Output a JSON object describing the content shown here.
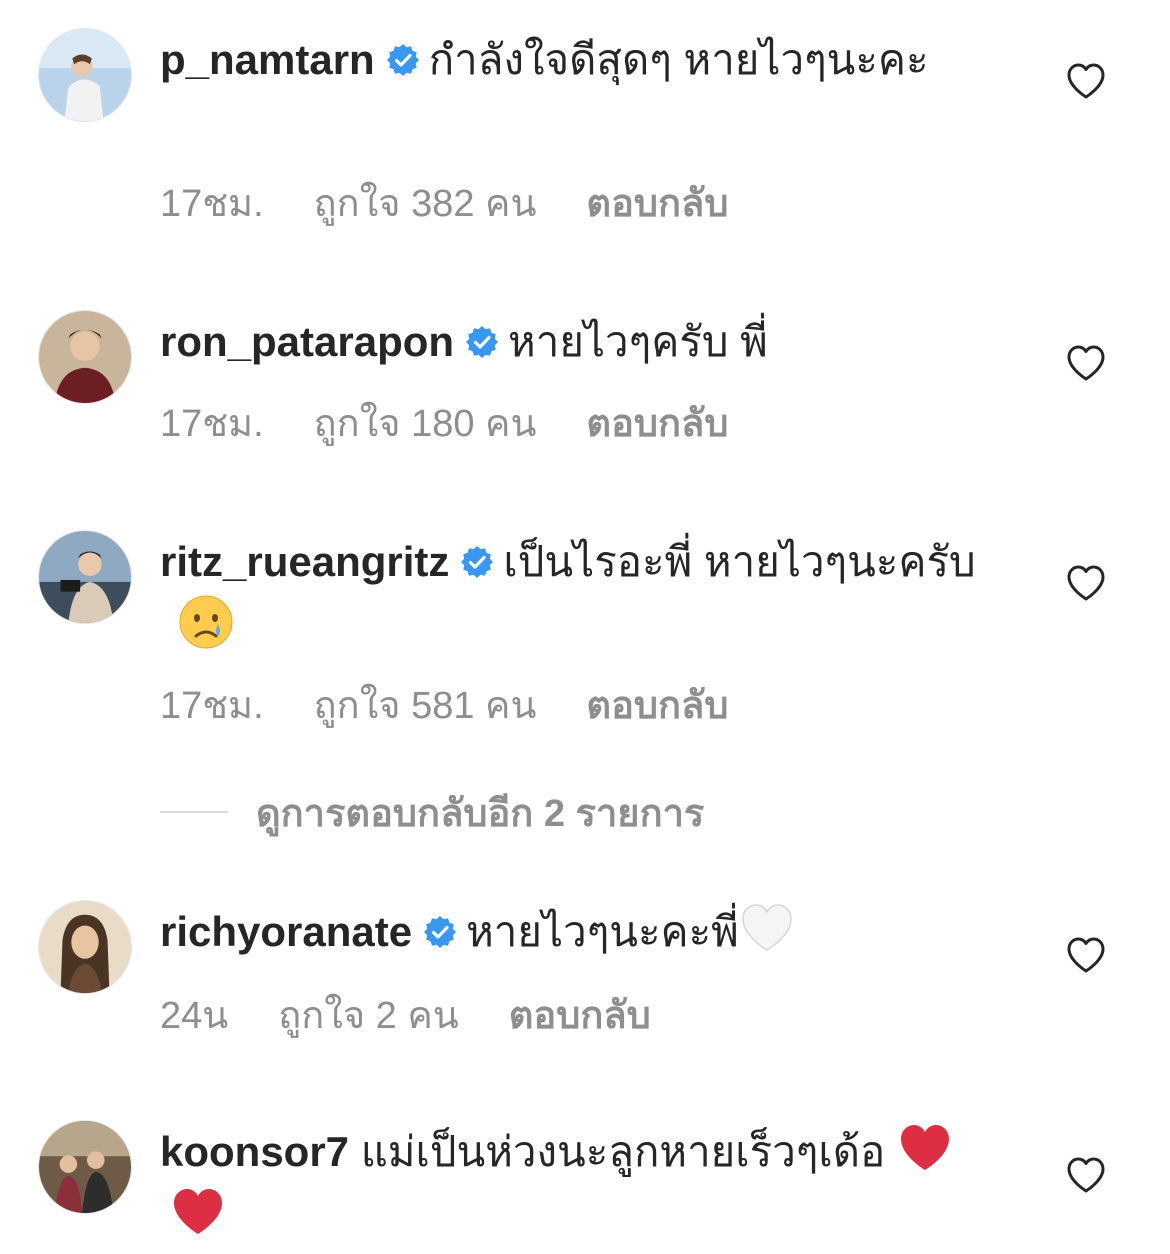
{
  "comments": [
    {
      "username": "p_namtarn",
      "verified": true,
      "text": "กำลังใจดีสุดๆ หายไวๆนะคะ",
      "time": "17ชม.",
      "likes": "ถูกใจ 382 คน",
      "reply": "ตอบกลับ"
    },
    {
      "username": "ron_patarapon",
      "verified": true,
      "text": "หายไวๆครับ พี่",
      "time": "17ชม.",
      "likes": "ถูกใจ 180 คน",
      "reply": "ตอบกลับ"
    },
    {
      "username": "ritz_rueangritz",
      "verified": true,
      "text": "เป็นไรอะพี่ หายไวๆนะครับ",
      "emoji": "crying-face-emoji",
      "time": "17ชม.",
      "likes": "ถูกใจ 581 คน",
      "reply": "ตอบกลับ"
    },
    {
      "username": "richyoranate",
      "verified": true,
      "text": "หายไวๆนะคะพี่",
      "emoji": "white-heart-emoji",
      "time": "24น",
      "likes": "ถูกใจ 2 คน",
      "reply": "ตอบกลับ"
    },
    {
      "username": "koonsor7",
      "verified": false,
      "text": "แม่เป็นห่วงนะลูกหายเร็วๆเด้อ",
      "emoji": "red-heart-emoji"
    }
  ],
  "view_replies": "ดูการตอบกลับอีก 2 รายการ",
  "colors": {
    "text": "#262626",
    "secondary": "#8e8e8e",
    "verified_blue": "#3897f0",
    "divider": "#dbdbdb"
  }
}
